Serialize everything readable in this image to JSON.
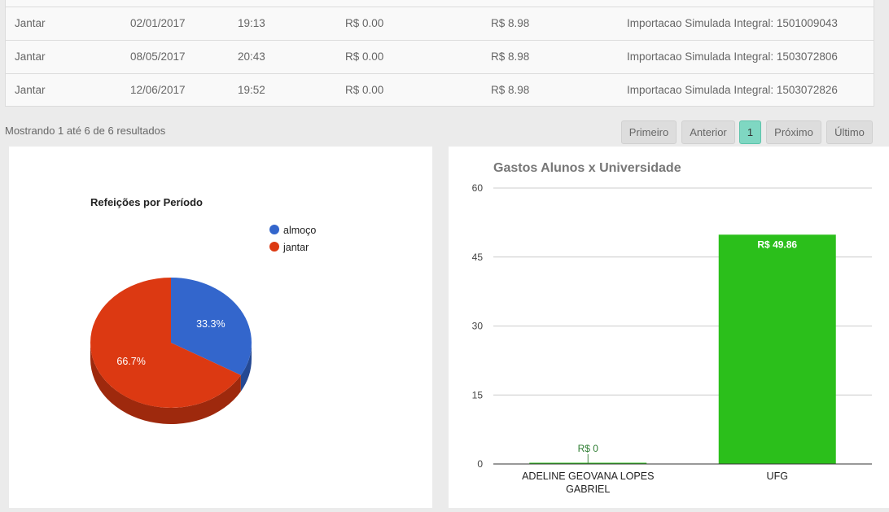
{
  "table": {
    "rows": [
      [
        "Jantar",
        "02/01/2017",
        "19:13",
        "R$ 0.00",
        "R$ 8.98",
        "Importacao Simulada Integral: 1501009043"
      ],
      [
        "Jantar",
        "08/05/2017",
        "20:43",
        "R$ 0.00",
        "R$ 8.98",
        "Importacao Simulada Integral: 1503072806"
      ],
      [
        "Jantar",
        "12/06/2017",
        "19:52",
        "R$ 0.00",
        "R$ 8.98",
        "Importacao Simulada Integral: 1503072826"
      ]
    ]
  },
  "results_text": "Mostrando 1 até 6 de 6 resultados",
  "pagination": {
    "first": "Primeiro",
    "prev": "Anterior",
    "current": "1",
    "next": "Próximo",
    "last": "Último"
  },
  "chart_data": [
    {
      "type": "pie",
      "title": "Refeições por Período",
      "labels": [
        "almoço",
        "jantar"
      ],
      "values": [
        33.3,
        66.7
      ],
      "value_labels": [
        "33.3%",
        "66.7%"
      ],
      "colors": [
        "#3366cc",
        "#dc3912"
      ],
      "legend": "top-right",
      "style": "3d"
    },
    {
      "type": "bar",
      "title": "Gastos Alunos x Universidade",
      "categories": [
        "ADELINE GEOVANA LOPES GABRIEL",
        "UFG"
      ],
      "values": [
        0,
        49.86
      ],
      "value_labels": [
        "R$ 0",
        "R$ 49.86"
      ],
      "ylim": [
        0,
        60
      ],
      "yticks": [
        0,
        15,
        30,
        45,
        60
      ],
      "color": "#2bbf1b",
      "grid": true
    }
  ]
}
